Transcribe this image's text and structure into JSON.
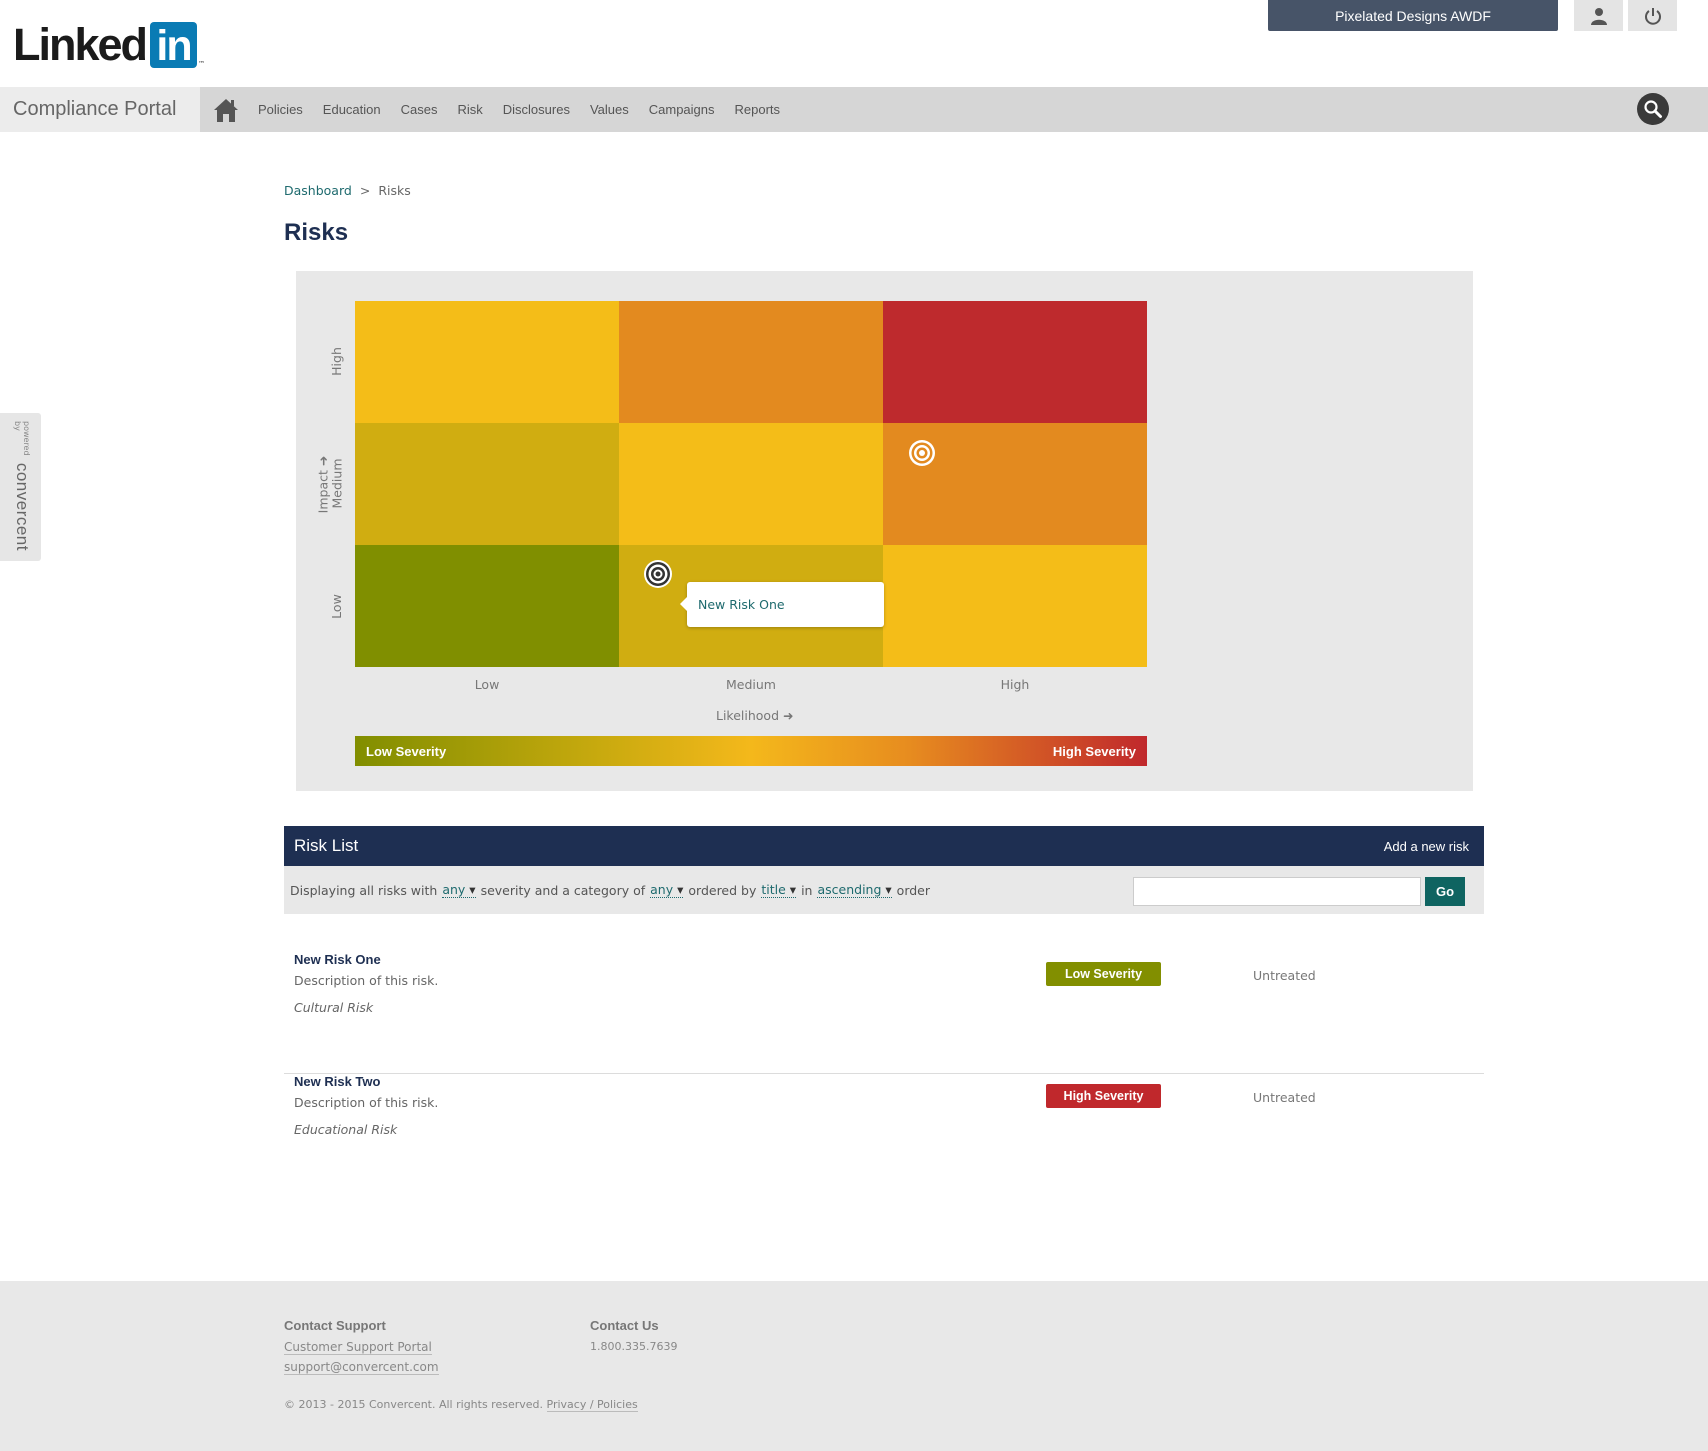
{
  "header": {
    "logo_word": "Linked",
    "logo_box": "in",
    "logo_tm": "™",
    "account_name": "Pixelated Designs AWDF"
  },
  "nav": {
    "portal_title": "Compliance Portal",
    "items": [
      "Policies",
      "Education",
      "Cases",
      "Risk",
      "Disclosures",
      "Values",
      "Campaigns",
      "Reports"
    ]
  },
  "side_tab": {
    "small": "powered by",
    "brand": "convercent"
  },
  "breadcrumb": {
    "root": "Dashboard",
    "separator": ">",
    "current": "Risks"
  },
  "page_title": "Risks",
  "matrix": {
    "y_axis_label": "Impact ➜",
    "x_axis_label": "Likelihood ➜",
    "y_levels": [
      "High",
      "Medium",
      "Low"
    ],
    "x_levels": [
      "Low",
      "Medium",
      "High"
    ],
    "cell_colors": [
      [
        "#f4bd18",
        "#e38a1f",
        "#be2a2d"
      ],
      [
        "#d0ad11",
        "#f4bd18",
        "#e38a1f"
      ],
      [
        "#808f00",
        "#d0ad11",
        "#f4bd18"
      ]
    ],
    "callout": "New Risk One",
    "severity_low": "Low Severity",
    "severity_high": "High Severity"
  },
  "risk_list": {
    "title": "Risk List",
    "add_label": "Add a new risk",
    "filter": {
      "t1": "Displaying all risks with",
      "severity": "any",
      "t2": "severity and a category of",
      "category": "any",
      "t3": "ordered by",
      "order_by": "title",
      "t4": "in",
      "direction": "ascending",
      "t5": "order",
      "search_value": "",
      "go": "Go"
    },
    "risks": [
      {
        "name": "New Risk One",
        "description": "Description of this risk.",
        "category": "Cultural Risk",
        "severity": "Low Severity",
        "severity_color": "#828f00",
        "status": "Untreated"
      },
      {
        "name": "New Risk Two",
        "description": "Description of this risk.",
        "category": "Educational Risk",
        "severity": "High Severity",
        "severity_color": "#c0282c",
        "status": "Untreated"
      }
    ]
  },
  "footer": {
    "support_head": "Contact Support",
    "support_portal": "Customer Support Portal",
    "support_email": "support@convercent.com",
    "contact_head": "Contact Us",
    "phone": "1.800.335.7639",
    "copyright": "© 2013 - 2015 Convercent. All rights reserved.",
    "privacy_link": "Privacy / Policies"
  }
}
